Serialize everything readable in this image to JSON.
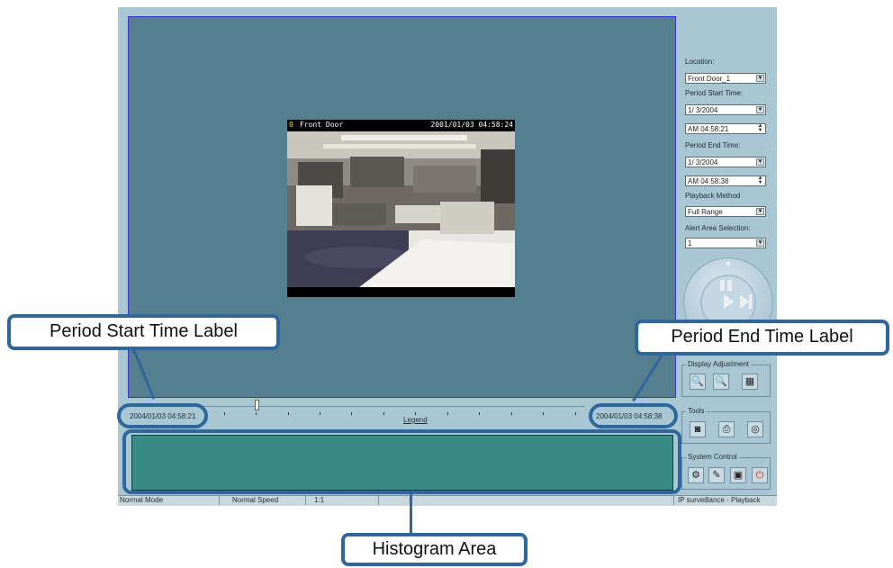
{
  "camera": {
    "channel": "0",
    "name": "Front Door",
    "timestamp": "2001/01/03 04:58:24"
  },
  "panel": {
    "location_label": "Location:",
    "location_value": "Front Door_1",
    "period_start_label": "Period Start Time:",
    "period_start_date": "1/ 3/2004",
    "period_start_time": "AM 04:58:21",
    "period_end_label": "Period End Time:",
    "period_end_date": "1/ 3/2004",
    "period_end_time": "AM 04:58:38",
    "playback_method_label": "Playback Method",
    "playback_method_value": "Full Range",
    "alert_area_label": "Alert Area Selection:",
    "alert_area_value": "1",
    "display_adjustment_label": "Display Adjustment",
    "tools_label": "Tools",
    "system_control_label": "System Control"
  },
  "timeline": {
    "start_time": "2004/01/03 04:58:21",
    "end_time": "2004/01/03 04:58:38",
    "legend_label": "Legend"
  },
  "status_bar": {
    "mode": "Normal Mode",
    "speed": "Normal Speed",
    "ratio": "1:1",
    "app_name": "IP surveillance - Playback"
  },
  "callouts": {
    "start_time": "Period Start Time Label",
    "end_time": "Period End Time Label",
    "histogram": "Histogram Area"
  },
  "colors": {
    "video_bg": "#557f8e",
    "app_bg": "#a9c7d3",
    "histogram_bg": "#388b86",
    "callout_border": "#2f679d"
  }
}
